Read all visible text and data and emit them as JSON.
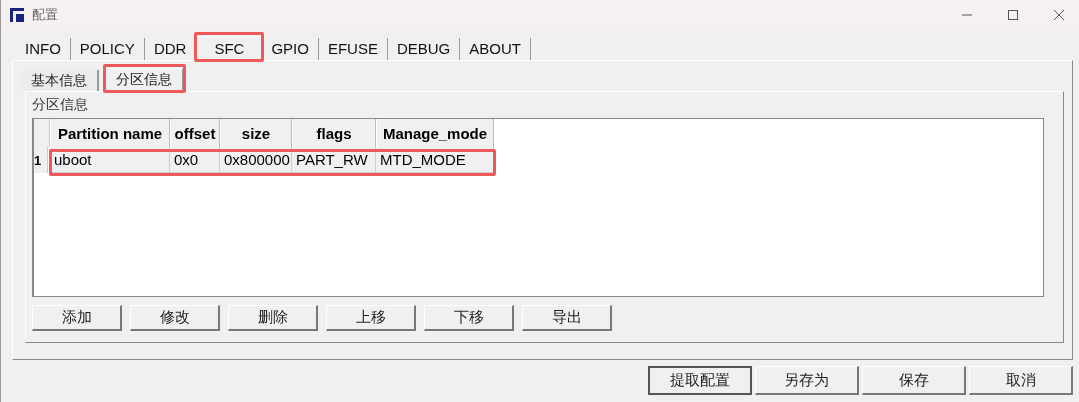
{
  "window": {
    "title": "配置"
  },
  "tabs": [
    {
      "label": "INFO",
      "selected": false,
      "highlighted": false
    },
    {
      "label": "POLICY",
      "selected": false,
      "highlighted": false
    },
    {
      "label": "DDR",
      "selected": false,
      "highlighted": false
    },
    {
      "label": "SFC",
      "selected": true,
      "highlighted": true
    },
    {
      "label": "GPIO",
      "selected": false,
      "highlighted": false
    },
    {
      "label": "EFUSE",
      "selected": false,
      "highlighted": false
    },
    {
      "label": "DEBUG",
      "selected": false,
      "highlighted": false
    },
    {
      "label": "ABOUT",
      "selected": false,
      "highlighted": false
    }
  ],
  "subtabs": [
    {
      "label": "基本信息",
      "selected": false,
      "highlighted": false
    },
    {
      "label": "分区信息",
      "selected": true,
      "highlighted": true
    }
  ],
  "group": {
    "title": "分区信息"
  },
  "table": {
    "columns": [
      "Partition name",
      "offset",
      "size",
      "flags",
      "Manage_mode"
    ],
    "rows": [
      {
        "number": "1",
        "highlighted": true,
        "cells": [
          "uboot",
          "0x0",
          "0x800000",
          "PART_RW",
          "MTD_MODE"
        ]
      }
    ]
  },
  "table_buttons": [
    "添加",
    "修改",
    "删除",
    "上移",
    "下移",
    "导出"
  ],
  "buttons": [
    {
      "label": "提取配置",
      "default": true
    },
    {
      "label": "另存为",
      "default": false
    },
    {
      "label": "保存",
      "default": false
    },
    {
      "label": "取消",
      "default": false
    }
  ]
}
